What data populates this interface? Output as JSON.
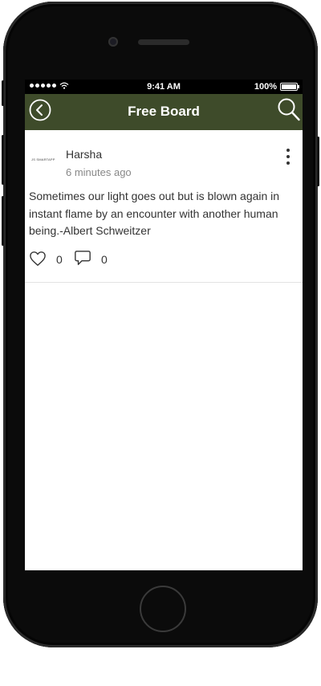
{
  "status_bar": {
    "time": "9:41 AM",
    "battery": "100%",
    "signal_icon": "signal-dots-icon",
    "wifi_icon": "wifi-icon",
    "battery_icon": "battery-icon"
  },
  "header": {
    "title": "Free Board",
    "back_icon": "back-circle-icon",
    "search_icon": "search-icon",
    "background_color": "#3e4b2a"
  },
  "post": {
    "avatar_text": "JS SMARTAPP",
    "author": "Harsha",
    "time": "6 minutes ago",
    "body": "Sometimes our light goes out but is blown again in instant flame by an encounter with another human being.-Albert Schweitzer",
    "like_count": "0",
    "comment_count": "0",
    "like_icon": "heart-icon",
    "comment_icon": "comment-bubble-icon",
    "more_icon": "more-vertical-icon"
  }
}
